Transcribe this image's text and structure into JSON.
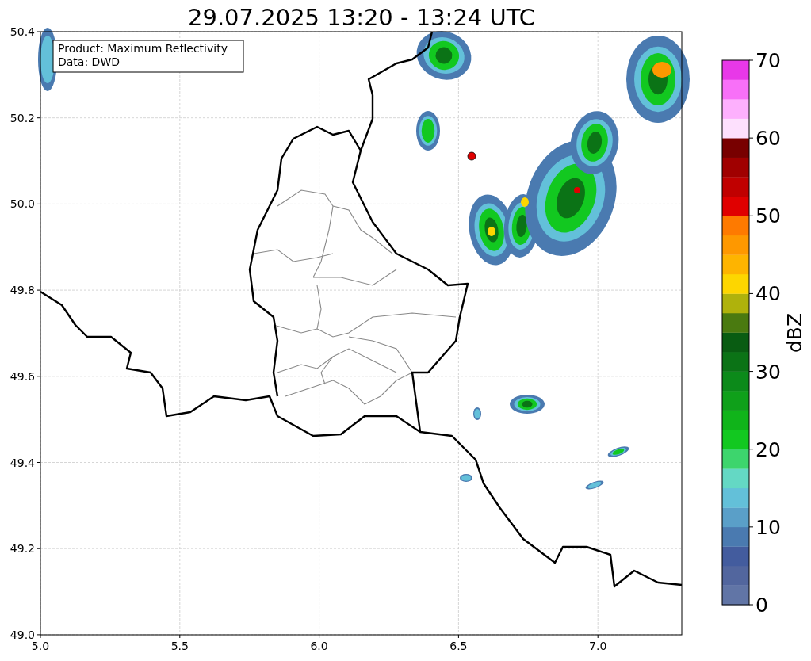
{
  "title": "29.07.2025 13:20 - 13:24 UTC",
  "info_box": [
    "Product: Maximum Reflectivity",
    "Data: DWD"
  ],
  "x_ticks": [
    "5.0",
    "5.5",
    "6.0",
    "6.5",
    "7.0"
  ],
  "y_ticks": [
    "50.4",
    "50.2",
    "50.0",
    "49.8",
    "49.6",
    "49.4",
    "49.2",
    "49.0"
  ],
  "colorbar": {
    "label": "dBZ",
    "ticks": [
      "70",
      "60",
      "50",
      "40",
      "30",
      "20",
      "10",
      "0"
    ],
    "bins": [
      {
        "color": "#6175a6"
      },
      {
        "color": "#52669e"
      },
      {
        "color": "#435c9e"
      },
      {
        "color": "#4a7ab0"
      },
      {
        "color": "#5a9fc8"
      },
      {
        "color": "#63c0d9"
      },
      {
        "color": "#64d8c4"
      },
      {
        "color": "#3dd56d"
      },
      {
        "color": "#12c820"
      },
      {
        "color": "#10b41a"
      },
      {
        "color": "#0fa01a"
      },
      {
        "color": "#0c8a1a"
      },
      {
        "color": "#0b7316"
      },
      {
        "color": "#095c12"
      },
      {
        "color": "#4a7a10"
      },
      {
        "color": "#afb20c"
      },
      {
        "color": "#fdd600"
      },
      {
        "color": "#feb400"
      },
      {
        "color": "#fe9800"
      },
      {
        "color": "#fe7a00"
      },
      {
        "color": "#e00000"
      },
      {
        "color": "#c00000"
      },
      {
        "color": "#a00000"
      },
      {
        "color": "#780000"
      },
      {
        "color": "#fde0fd"
      },
      {
        "color": "#fdb0fd"
      },
      {
        "color": "#f870f8"
      },
      {
        "color": "#e838e8"
      }
    ]
  }
}
